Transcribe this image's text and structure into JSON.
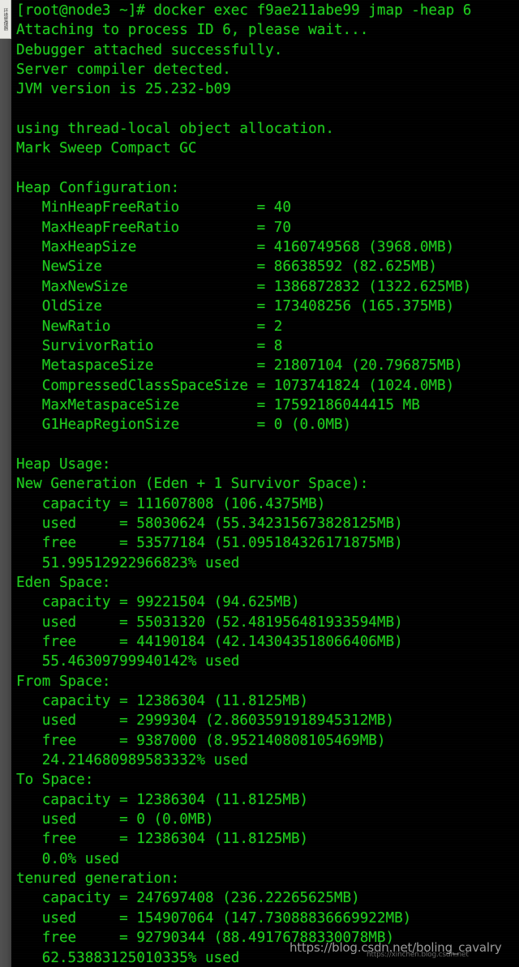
{
  "window": {
    "app": "terminal",
    "background_color": "#000000",
    "text_color": "#1ecb1e",
    "gutter_color": "#474747"
  },
  "sidebar_tab": {
    "label": "环境管理器"
  },
  "terminal": {
    "prompt": "[root@node3 ~]#",
    "command": "docker exec f9ae211abe99 jmap -heap 6",
    "lines": [
      "[root@node3 ~]# docker exec f9ae211abe99 jmap -heap 6",
      "Attaching to process ID 6, please wait...",
      "Debugger attached successfully.",
      "Server compiler detected.",
      "JVM version is 25.232-b09",
      "",
      "using thread-local object allocation.",
      "Mark Sweep Compact GC",
      "",
      "Heap Configuration:",
      "   MinHeapFreeRatio         = 40",
      "   MaxHeapFreeRatio         = 70",
      "   MaxHeapSize              = 4160749568 (3968.0MB)",
      "   NewSize                  = 86638592 (82.625MB)",
      "   MaxNewSize               = 1386872832 (1322.625MB)",
      "   OldSize                  = 173408256 (165.375MB)",
      "   NewRatio                 = 2",
      "   SurvivorRatio            = 8",
      "   MetaspaceSize            = 21807104 (20.796875MB)",
      "   CompressedClassSpaceSize = 1073741824 (1024.0MB)",
      "   MaxMetaspaceSize         = 17592186044415 MB",
      "   G1HeapRegionSize         = 0 (0.0MB)",
      "",
      "Heap Usage:",
      "New Generation (Eden + 1 Survivor Space):",
      "   capacity = 111607808 (106.4375MB)",
      "   used     = 58030624 (55.342315673828125MB)",
      "   free     = 53577184 (51.095184326171875MB)",
      "   51.99512922966823% used",
      "Eden Space:",
      "   capacity = 99221504 (94.625MB)",
      "   used     = 55031320 (52.481956481933594MB)",
      "   free     = 44190184 (42.143043518066406MB)",
      "   55.46309799940142% used",
      "From Space:",
      "   capacity = 12386304 (11.8125MB)",
      "   used     = 2999304 (2.8603591918945312MB)",
      "   free     = 9387000 (8.952140808105469MB)",
      "   24.214680989583332% used",
      "To Space:",
      "   capacity = 12386304 (11.8125MB)",
      "   used     = 0 (0.0MB)",
      "   free     = 12386304 (11.8125MB)",
      "   0.0% used",
      "tenured generation:",
      "   capacity = 247697408 (236.22265625MB)",
      "   used     = 154907064 (147.73088836669922MB)",
      "   free     = 92790344 (88.49176788330078MB)",
      "   62.53883125010335% used"
    ]
  },
  "watermarks": {
    "main": "https://blog.csdn.net/boling_cavalry",
    "sub": "https://xinchen.blog.csdn.net"
  }
}
